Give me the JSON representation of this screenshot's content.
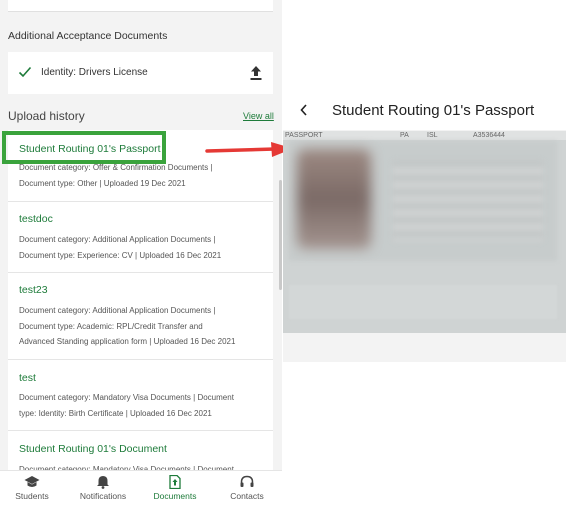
{
  "acceptance": {
    "section_title": "Additional Acceptance Documents",
    "identity_label": "Identity: Drivers License"
  },
  "history": {
    "title": "Upload history",
    "view_all": "View all",
    "items": [
      {
        "title": "Student Routing 01's Passport",
        "line1": "Document category: Offer & Confirmation Documents |",
        "line2": "Document type: Other | Uploaded 19 Dec 2021",
        "line3": ""
      },
      {
        "title": "testdoc",
        "line1": "Document category: Additional Application Documents |",
        "line2": "Document type: Experience: CV | Uploaded 16 Dec 2021",
        "line3": ""
      },
      {
        "title": "test23",
        "line1": "Document category: Additional Application Documents |",
        "line2": "Document type: Academic: RPL/Credit Transfer and",
        "line3": "Advanced Standing application form | Uploaded 16 Dec 2021"
      },
      {
        "title": "test",
        "line1": "Document category: Mandatory Visa Documents | Document",
        "line2": "type: Identity: Birth Certificate | Uploaded 16 Dec 2021",
        "line3": ""
      },
      {
        "title": "Student Routing 01's Document",
        "line1": "Document category: Mandatory Visa Documents | Document",
        "line2": "",
        "line3": ""
      }
    ]
  },
  "nav": {
    "items": [
      {
        "label": "Students",
        "icon": "graduation-cap-icon"
      },
      {
        "label": "Notifications",
        "icon": "bell-icon"
      },
      {
        "label": "Documents",
        "icon": "document-upload-icon",
        "active": true
      },
      {
        "label": "Contacts",
        "icon": "headset-icon"
      }
    ]
  },
  "viewer": {
    "title": "Student Routing 01's Passport",
    "passport_header": {
      "label": "PASSPORT",
      "code1": "PA",
      "code2": "ISL",
      "number": "A3536444"
    }
  },
  "colors": {
    "accent": "#1e7b3a",
    "highlight": "#3aa33c",
    "arrow": "#e53935"
  }
}
